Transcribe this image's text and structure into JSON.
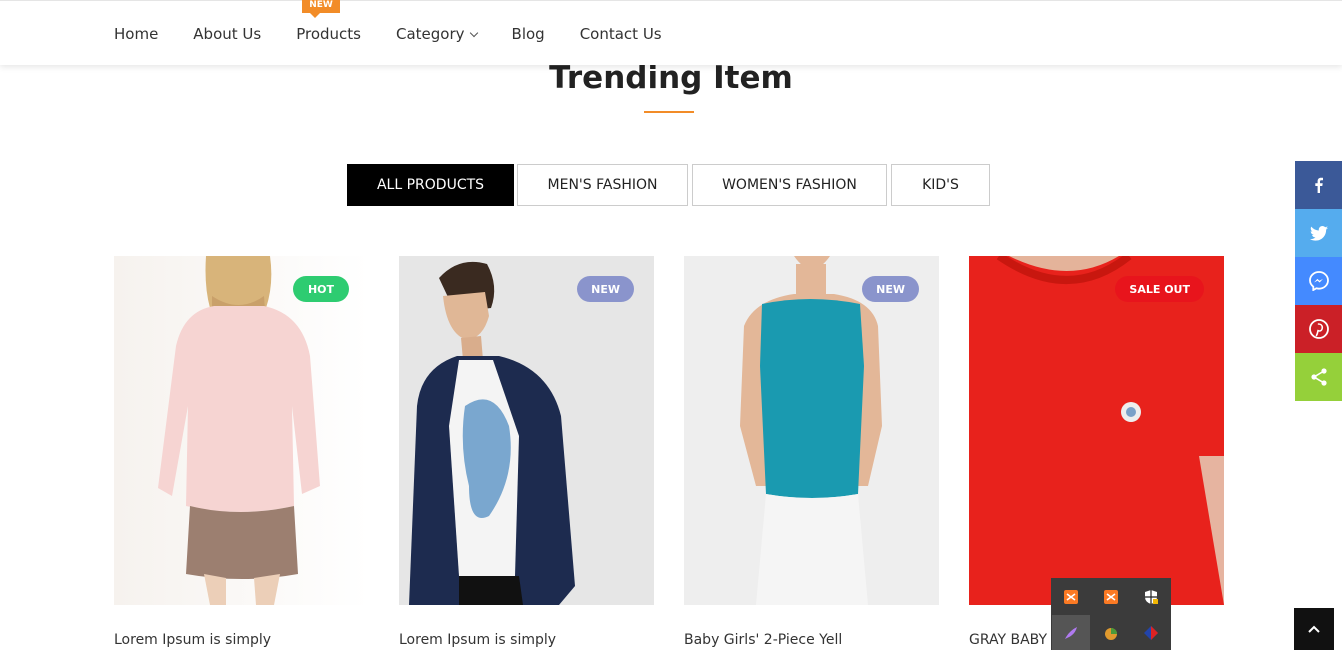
{
  "nav": {
    "items": [
      {
        "label": "Home"
      },
      {
        "label": "About Us"
      },
      {
        "label": "Products",
        "tag": "NEW"
      },
      {
        "label": "Category"
      },
      {
        "label": "Blog"
      },
      {
        "label": "Contact Us"
      }
    ]
  },
  "section": {
    "title": "Trending Item"
  },
  "tabs": [
    "ALL PRODUCTS",
    "MEN'S FASHION",
    "WOMEN'S FASHION",
    "KID'S"
  ],
  "products": [
    {
      "name": "Lorem Ipsum is simply",
      "badge": "HOT",
      "badge_color": "#2ecc71"
    },
    {
      "name": "Lorem Ipsum is simply",
      "badge": "NEW",
      "badge_color": "#8a94cc"
    },
    {
      "name": "Baby Girls' 2-Piece Yell",
      "badge": "NEW",
      "badge_color": "#8a94cc"
    },
    {
      "name": "GRAY BABY",
      "badge": "SALE OUT",
      "badge_color": "#e8141c"
    }
  ],
  "social": [
    {
      "icon": "facebook-icon",
      "color": "#3b5998"
    },
    {
      "icon": "twitter-icon",
      "color": "#55acee"
    },
    {
      "icon": "messenger-icon",
      "color": "#448aff"
    },
    {
      "icon": "pinterest-icon",
      "color": "#cb2027"
    },
    {
      "icon": "share-icon",
      "color": "#95d03a"
    }
  ],
  "colors": {
    "accent": "#f28c28",
    "tab_active_bg": "#000000"
  }
}
